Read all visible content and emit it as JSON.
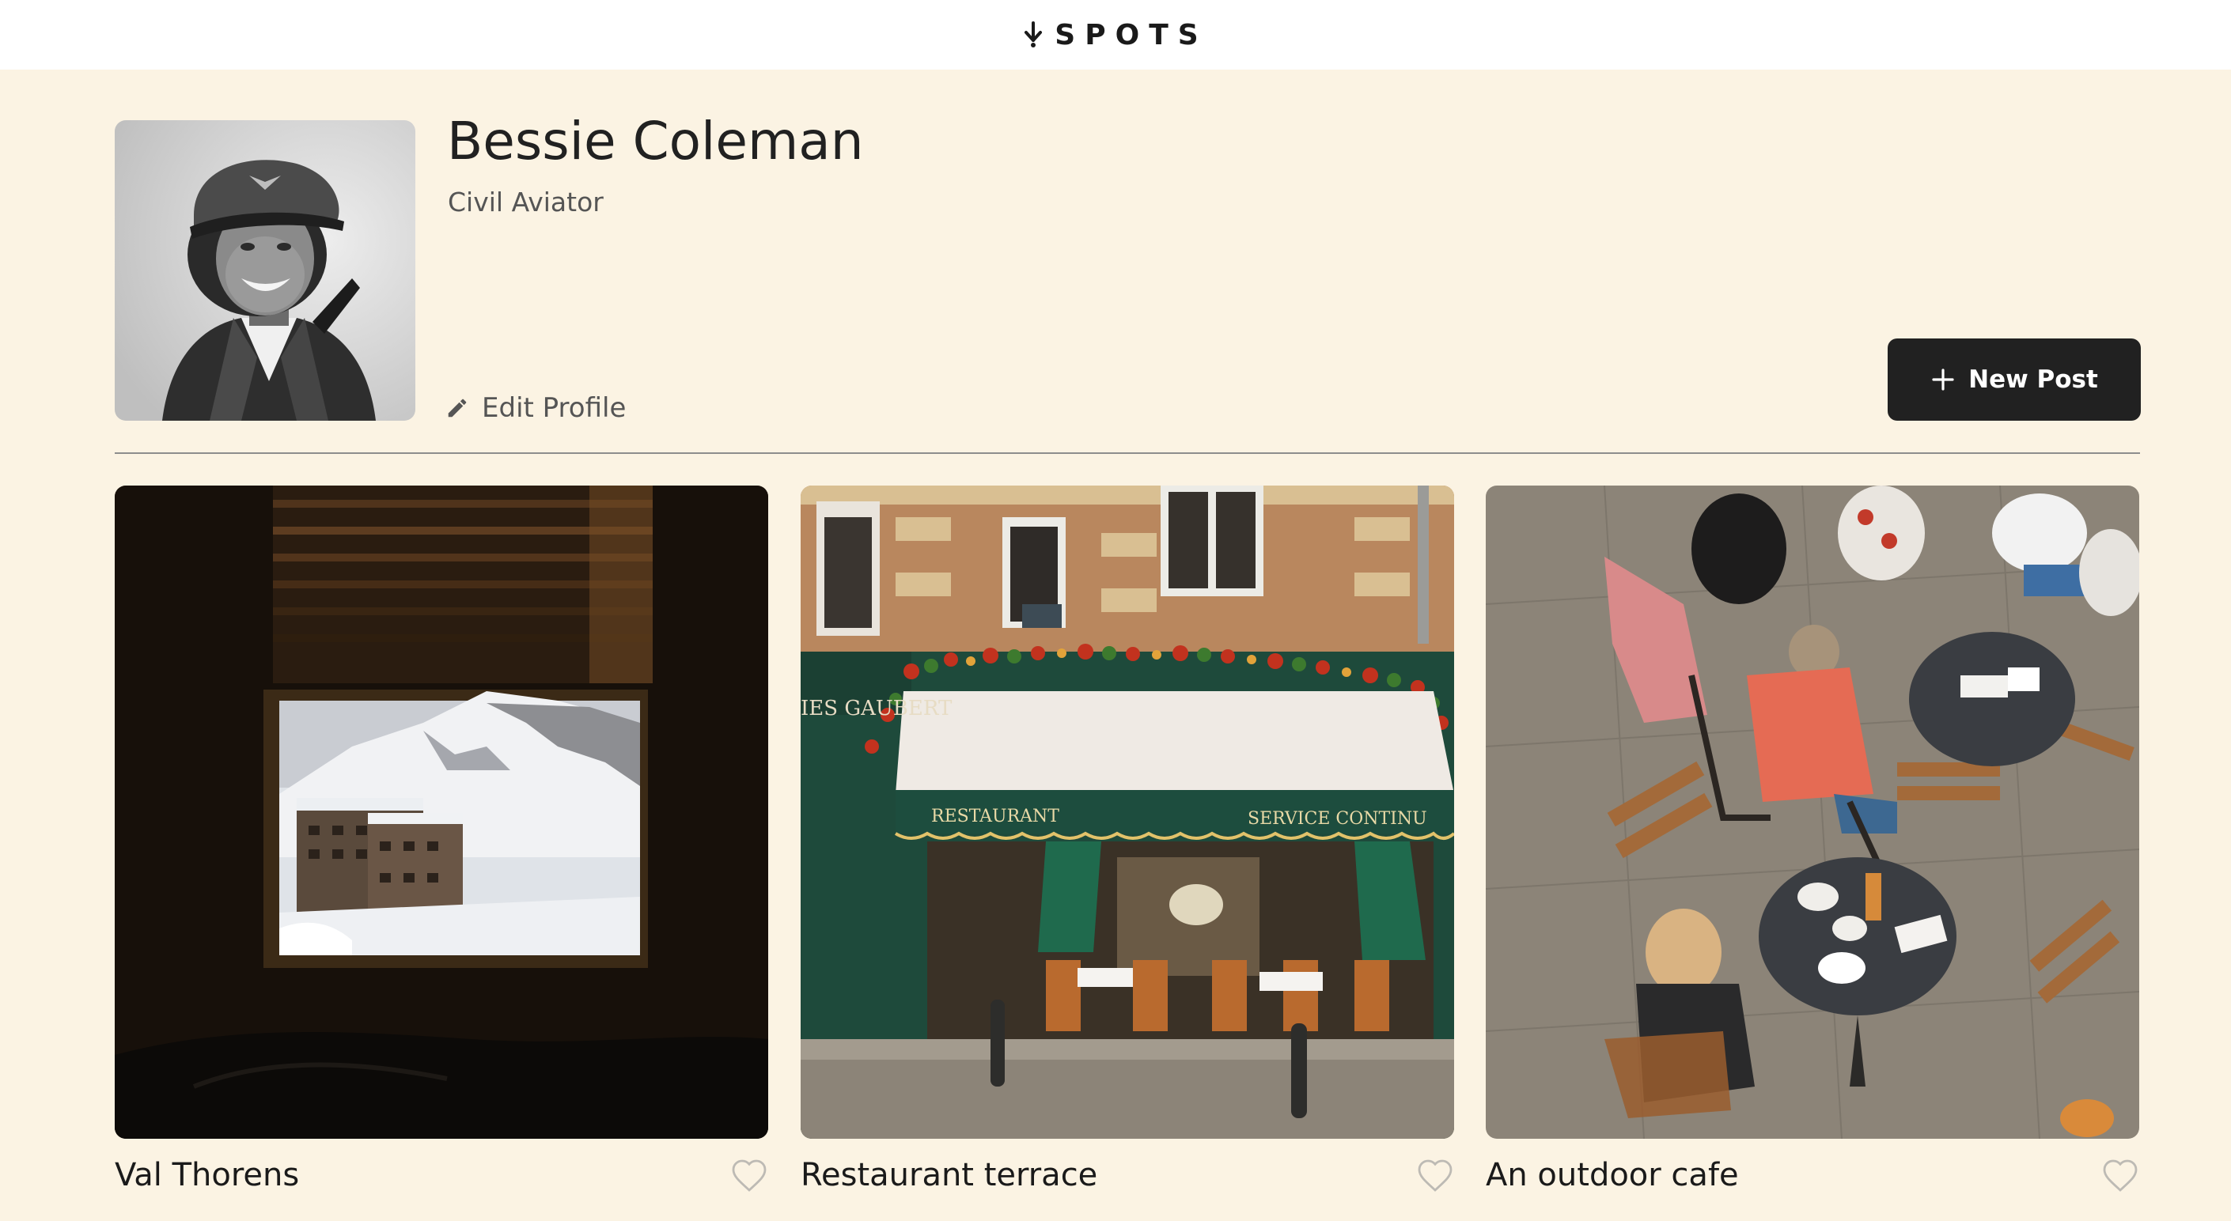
{
  "header": {
    "logo_text": "SPOTS",
    "logo_icon": "spots-logo-icon"
  },
  "profile": {
    "name": "Bessie Coleman",
    "description": "Civil Aviator",
    "edit_label": "Edit Profile",
    "avatar_icon": "avatar"
  },
  "actions": {
    "new_post_label": "New Post"
  },
  "cards": [
    {
      "title": "Val Thorens",
      "liked": false
    },
    {
      "title": "Restaurant terrace",
      "liked": false
    },
    {
      "title": "An outdoor cafe",
      "liked": false
    }
  ],
  "colors": {
    "background": "#fbf3e3",
    "header": "#ffffff",
    "button": "#212121",
    "text": "#1f1f1f",
    "muted": "#555555"
  }
}
